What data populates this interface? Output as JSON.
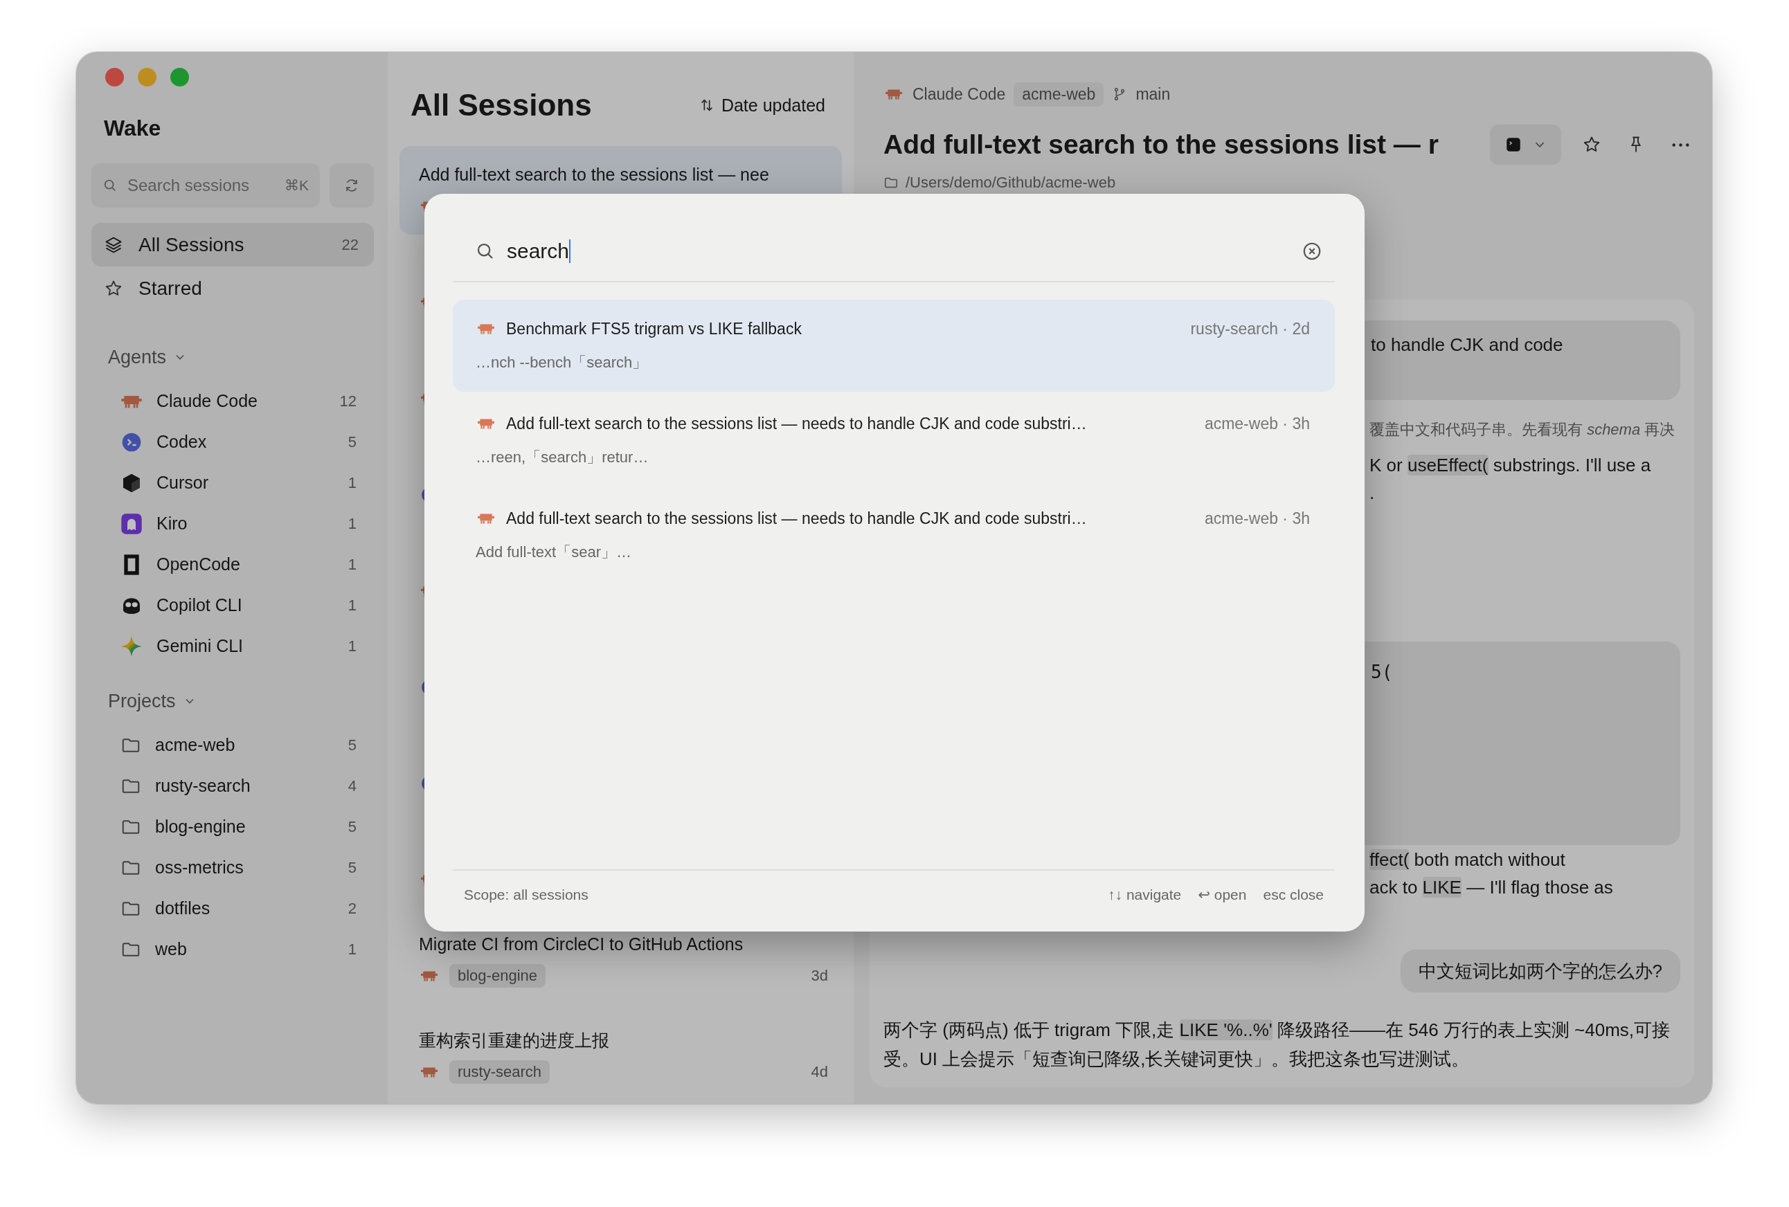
{
  "sidebar": {
    "app_name": "Wake",
    "search": {
      "placeholder": "Search sessions",
      "shortcut": "⌘K"
    },
    "nav": [
      {
        "label": "All Sessions",
        "count": "22",
        "kind": "layers",
        "selected": true
      },
      {
        "label": "Starred",
        "kind": "star",
        "selected": false
      }
    ],
    "agents_header": {
      "label": "Agents",
      "expanded": true
    },
    "agents": [
      {
        "name": "Claude Code",
        "kind": "claude",
        "count": "12"
      },
      {
        "name": "Codex",
        "kind": "codex",
        "count": "5"
      },
      {
        "name": "Cursor",
        "kind": "cursor",
        "count": "1"
      },
      {
        "name": "Kiro",
        "kind": "kiro",
        "count": "1"
      },
      {
        "name": "OpenCode",
        "kind": "opencode",
        "count": "1"
      },
      {
        "name": "Copilot CLI",
        "kind": "copilot",
        "count": "1"
      },
      {
        "name": "Gemini CLI",
        "kind": "gemini",
        "count": "1"
      }
    ],
    "projects_header": {
      "label": "Projects",
      "expanded": true
    },
    "projects": [
      {
        "name": "acme-web",
        "count": "5"
      },
      {
        "name": "rusty-search",
        "count": "4"
      },
      {
        "name": "blog-engine",
        "count": "5"
      },
      {
        "name": "oss-metrics",
        "count": "5"
      },
      {
        "name": "dotfiles",
        "count": "2"
      },
      {
        "name": "web",
        "count": "1"
      }
    ]
  },
  "session_list": {
    "title": "All Sessions",
    "sort": "Date updated",
    "items": [
      {
        "title": "Add full-text search to the sessions list — nee",
        "kind": "claude",
        "selected": true
      },
      {
        "kind": "claude",
        "selected": false
      },
      {
        "kind": "claude",
        "selected": false
      },
      {
        "kind": "codex",
        "selected": false
      },
      {
        "kind": "claude",
        "selected": false
      },
      {
        "kind": "codex",
        "selected": false
      },
      {
        "kind": "codex",
        "selected": false
      },
      {
        "kind": "claude",
        "selected": false
      },
      {
        "title": "Migrate CI from CircleCI to GitHub Actions",
        "kind": "claude",
        "project": "blog-engine",
        "time": "3d",
        "selected": false
      },
      {
        "title": "重构索引重建的进度上报",
        "kind": "claude",
        "project": "rusty-search",
        "time": "4d",
        "selected": false
      }
    ]
  },
  "detail": {
    "agent": {
      "name": "Claude Code",
      "kind": "claude"
    },
    "project": "acme-web",
    "branch": "main",
    "title": "Add full-text search to the sessions list — r",
    "path": "/Users/demo/Github/acme-web",
    "messages": [
      {
        "kind": "user_fragment",
        "text": "to handle CJK and code"
      },
      {
        "kind": "note_fragment",
        "text": "覆盖中文和代码子串。先看现有 *schema* 再决"
      },
      {
        "kind": "text_fragment",
        "segments": [
          {
            "kind": "text",
            "t": "K or "
          },
          {
            "kind": "code",
            "t": "useEffect("
          },
          {
            "kind": "text",
            "t": " substrings. I'll use a"
          }
        ]
      },
      {
        "kind": "text_fragment",
        "segments": [
          {
            "kind": "text",
            "t": "."
          }
        ]
      },
      {
        "kind": "code_fragment",
        "text": "5("
      },
      {
        "kind": "text_fragment",
        "segments": [
          {
            "kind": "code",
            "t": "ffect("
          },
          {
            "kind": "text",
            "t": " both match without"
          }
        ]
      },
      {
        "kind": "text_fragment",
        "segments": [
          {
            "kind": "text",
            "t": "ack to "
          },
          {
            "kind": "code",
            "t": "LIKE"
          },
          {
            "kind": "text",
            "t": " — I'll flag those as"
          }
        ]
      },
      {
        "kind": "user",
        "text": "中文短词比如两个字的怎么办?"
      },
      {
        "kind": "text",
        "segments": [
          {
            "kind": "text",
            "t": "两个字 (两码点) 低于 trigram 下限,走 "
          },
          {
            "kind": "code",
            "t": "LIKE '%..%'"
          },
          {
            "kind": "text",
            "t": " 降级路径——在 546 万行的表上实测 ~40ms,可接受。UI 上会提示「短查询已降级,长关键词更快」。我把这条也写进测试。"
          }
        ]
      }
    ]
  },
  "search_dialog": {
    "query": "search",
    "results": [
      {
        "title": "Benchmark FTS5 trigram vs LIKE fallback",
        "kind": "claude",
        "meta": "rusty-search · 2d",
        "snippet": "…nch --bench「search」",
        "selected": true
      },
      {
        "title": "Add full-text search to the sessions list — needs to handle CJK and code substri…",
        "kind": "claude",
        "meta": "acme-web · 3h",
        "snippet": "…reen,「search」retur…",
        "selected": false
      },
      {
        "title": "Add full-text search to the sessions list — needs to handle CJK and code substri…",
        "kind": "claude",
        "meta": "acme-web · 3h",
        "snippet": "Add full-text「sear」…",
        "selected": false
      }
    ],
    "scope": "Scope: all sessions",
    "hints": [
      "↑↓ navigate",
      "↩ open",
      "esc close"
    ]
  }
}
